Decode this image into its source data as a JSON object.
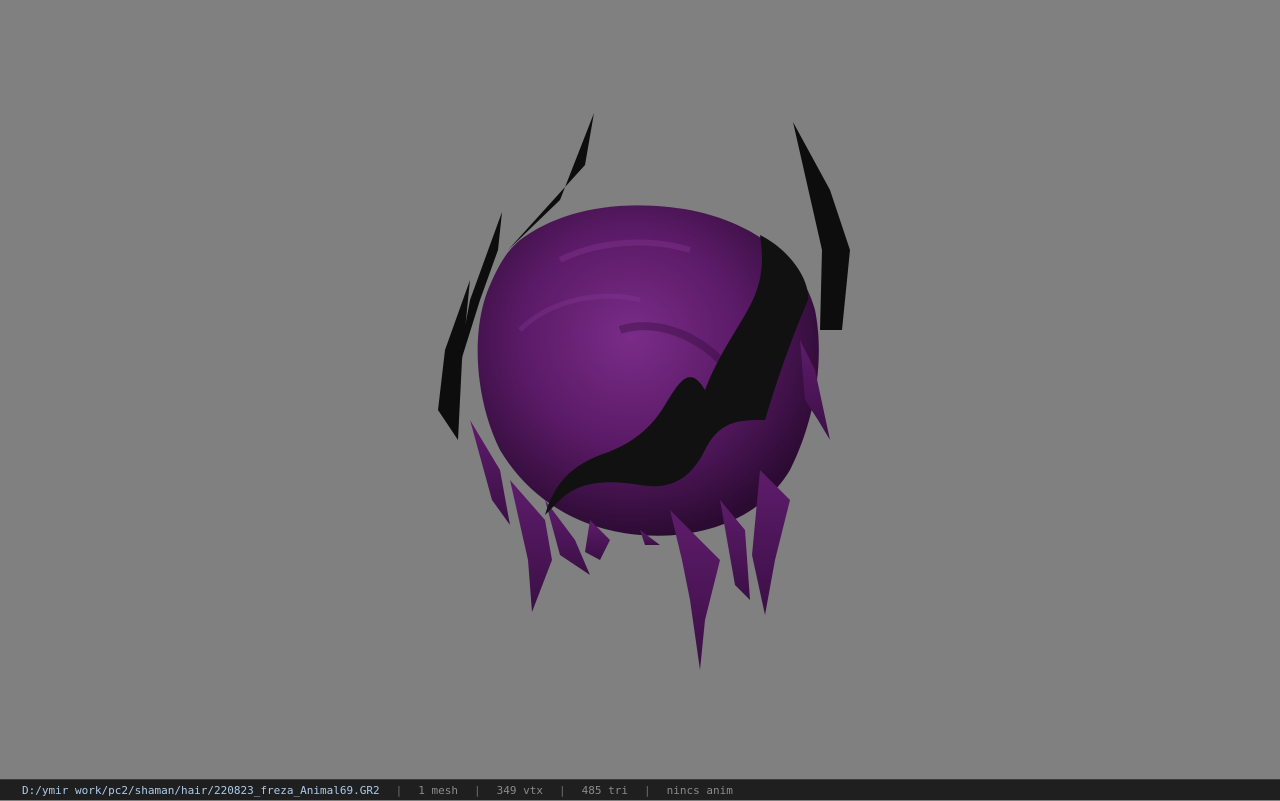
{
  "viewer": {
    "background_color": "#808080",
    "model": {
      "icon": "hair-mesh-model",
      "primary_color": "#5a1a66",
      "accent_color": "#111111"
    }
  },
  "status_bar": {
    "file_path": "D:/ymir work/pc2/shaman/hair/220823_freza_Animal69.GR2",
    "separator": "|",
    "mesh_count": "1 mesh",
    "vertex_count": "349 vtx",
    "triangle_count": "485 tri",
    "anim_status": "nincs anim"
  }
}
